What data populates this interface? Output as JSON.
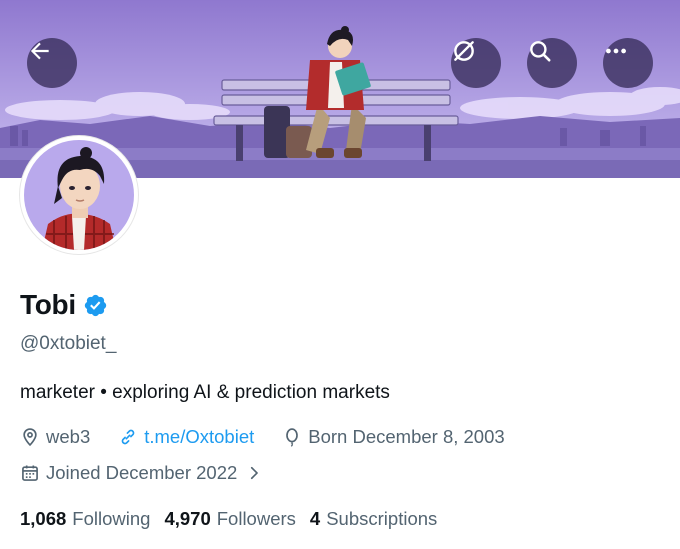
{
  "header": {
    "back_icon": "arrow-left-icon",
    "grok_icon": "grok-slash-circle-icon",
    "search_icon": "search-icon",
    "more_icon": "more-dots-icon"
  },
  "profile": {
    "display_name": "Tobi",
    "verified": true,
    "handle": "@0xtobiet_",
    "bio": "marketer • exploring AI & prediction markets",
    "location": "web3",
    "website": "t.me/Oxtobiet",
    "birth": "Born December 8, 2003",
    "joined": "Joined December 2022"
  },
  "stats": {
    "following_count": "1,068",
    "following_label": "Following",
    "followers_count": "4,970",
    "followers_label": "Followers",
    "subscriptions_count": "4",
    "subscriptions_label": "Subscriptions"
  },
  "colors": {
    "accent": "#1d9bf0",
    "banner_sky": "#9a86d6",
    "secondary_text": "#536471"
  }
}
